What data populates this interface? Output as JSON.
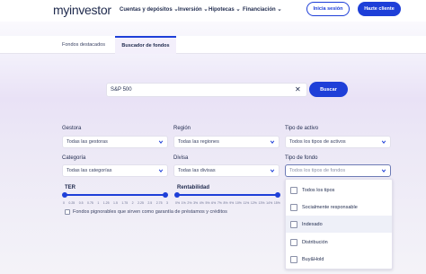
{
  "header": {
    "logo": "myinvestor",
    "nav": [
      "Cuentas y depósitos",
      "Inversión",
      "Hipotecas",
      "Financiación"
    ],
    "login_label": "Inicia sesión",
    "signup_label": "Hazte cliente"
  },
  "tabs": [
    "Fondos destacados",
    "Buscador de fondos"
  ],
  "active_tab": "Buscador de fondos",
  "search": {
    "value": "S&P 500",
    "button_label": "Buscar"
  },
  "filters": {
    "gestora": {
      "label": "Gestora",
      "value": "Todas las gestoras"
    },
    "region": {
      "label": "Región",
      "value": "Todas las regiones"
    },
    "tipo_activo": {
      "label": "Tipo de activo",
      "value": "Todos los tipos de activos"
    },
    "categoria": {
      "label": "Categoría",
      "value": "Todas las categorías"
    },
    "divisa": {
      "label": "Divisa",
      "value": "Todas las divisas"
    },
    "tipo_fondo": {
      "label": "Tipo de fondo",
      "placeholder": "Todos los tipos de fondos"
    }
  },
  "ter": {
    "label": "TER",
    "ticks": [
      "0",
      "0.25",
      "0.5",
      "0.75",
      "1",
      "1.25",
      "1.5",
      "1.75",
      "2",
      "2.25",
      "2.5",
      "2.75",
      "3"
    ]
  },
  "rentabilidad": {
    "label": "Rentabilidad",
    "ticks": [
      "0%",
      "1%",
      "2%",
      "3%",
      "4%",
      "5%",
      "6%",
      "7%",
      "8%",
      "9%",
      "10%",
      "11%",
      "12%",
      "13%",
      "14%",
      "15%"
    ]
  },
  "pignorable_text": "Fondos pignorables que sirven como garantía de préstamos y créditos",
  "fund_type_options": [
    "Todos los tipos",
    "Socialmente responsable",
    "Indexado",
    "Distribución",
    "Buy&Hold"
  ],
  "colors": {
    "brand": "#1e3fd8",
    "text": "#1f2a4d"
  }
}
